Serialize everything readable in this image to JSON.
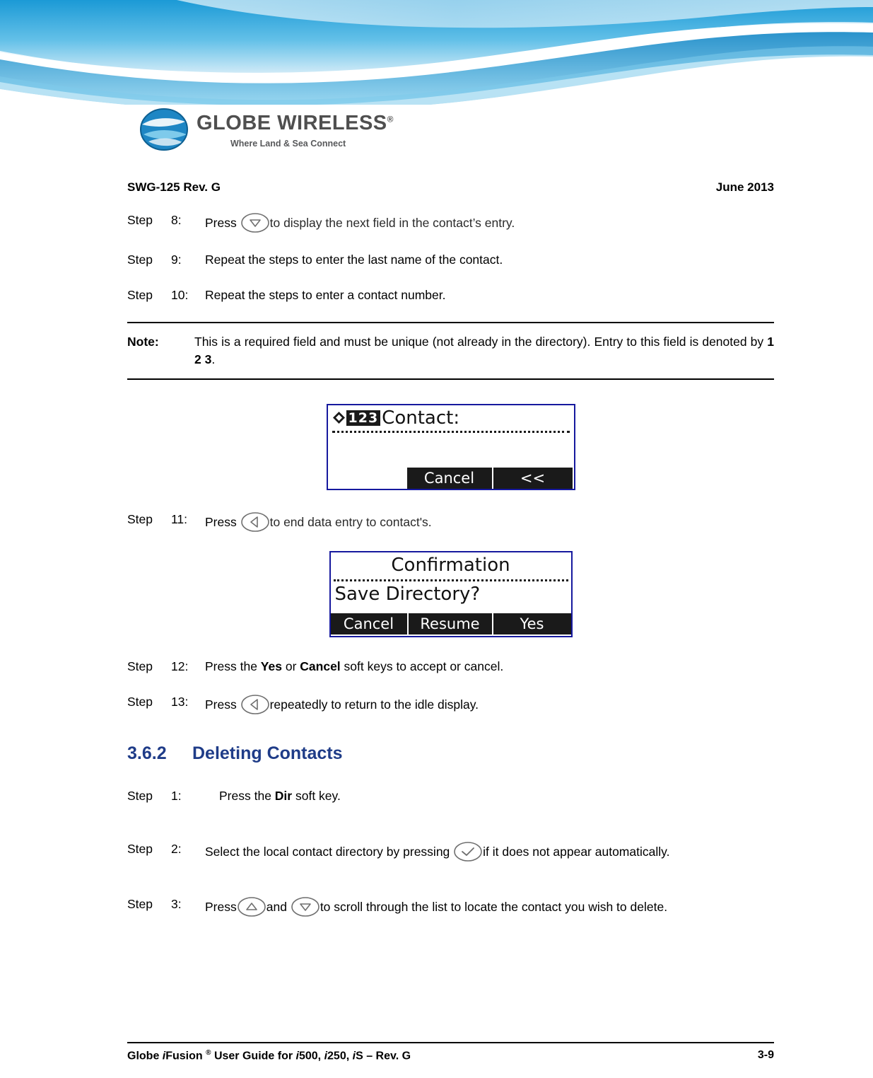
{
  "header": {
    "logo_text": "GLOBE WIRELESS",
    "logo_reg": "®",
    "logo_tagline": "Where Land & Sea Connect",
    "doc_id": "SWG-125 Rev. G",
    "date": "June 2013"
  },
  "steps_top": [
    {
      "label": "Step",
      "num": "8:",
      "pre": "Press",
      "icon": "down-arrow-key-icon",
      "text": "to display the next field in the contact’s entry.",
      "light": true
    },
    {
      "label": "Step",
      "num": "9:",
      "pre": "",
      "icon": "",
      "text": "Repeat the steps to enter the last name of the contact.",
      "light": false
    },
    {
      "label": "Step",
      "num": "10:",
      "pre": "",
      "icon": "",
      "text": "Repeat the steps to enter a contact number.",
      "light": false
    }
  ],
  "note": {
    "label": "Note:",
    "text_a": "This is a required field and must be unique (not already in the directory). Entry to this field is denoted by ",
    "bold": "1 2 3",
    "text_b": "."
  },
  "lcd_contact": {
    "indicator": "123",
    "title": "Contact:",
    "softkey_1": "Cancel",
    "softkey_2": "<<"
  },
  "step_11": {
    "label": "Step",
    "num": "11:",
    "pre": "Press",
    "icon": "left-arrow-key-icon",
    "text": "to end data entry to contact's."
  },
  "lcd_confirm": {
    "title": "Confirmation",
    "question": "Save Directory?",
    "softkey_1": "Cancel",
    "softkey_2": "Resume",
    "softkey_3": "Yes"
  },
  "step_12": {
    "label": "Step",
    "num": "12:",
    "text_a": "Press the ",
    "bold_a": "Yes",
    "text_b": " or ",
    "bold_b": "Cancel",
    "text_c": " soft keys to accept or cancel."
  },
  "step_13": {
    "label": "Step",
    "num": "13:",
    "pre": "Press",
    "icon": "left-arrow-key-icon",
    "text": "repeatedly to return to the idle display."
  },
  "section": {
    "number": "3.6.2",
    "title": "Deleting Contacts"
  },
  "steps_bottom": [
    {
      "label": "Step",
      "num": "1:",
      "text_a": "Press the ",
      "bold": "Dir",
      "text_b": " soft key."
    },
    {
      "label": "Step",
      "num": "2:",
      "text_a": "Select the local contact directory by pressing",
      "icon": "check-key-icon",
      "text_b": "if it does not appear automatically."
    },
    {
      "label": "Step",
      "num": "3:",
      "text_a": "Press",
      "icon_a": "up-arrow-key-icon",
      "text_b": "and",
      "icon_b": "down-arrow-key-icon",
      "text_c": "to scroll through the list to locate the contact you wish to delete."
    }
  ],
  "footer": {
    "left_1": "Globe ",
    "left_i": "i",
    "left_2": "Fusion ",
    "left_sup": "®",
    "left_3": " User Guide for ",
    "left_i2": "i",
    "left_4": "500, ",
    "left_i3": "i",
    "left_5": "250, ",
    "left_i4": "i",
    "left_6": "S – Rev. G",
    "page": "3-9"
  },
  "colors": {
    "heading_blue": "#1f3c88",
    "lcd_border": "#16199e",
    "swoosh_blue": "#3fa9dd"
  }
}
